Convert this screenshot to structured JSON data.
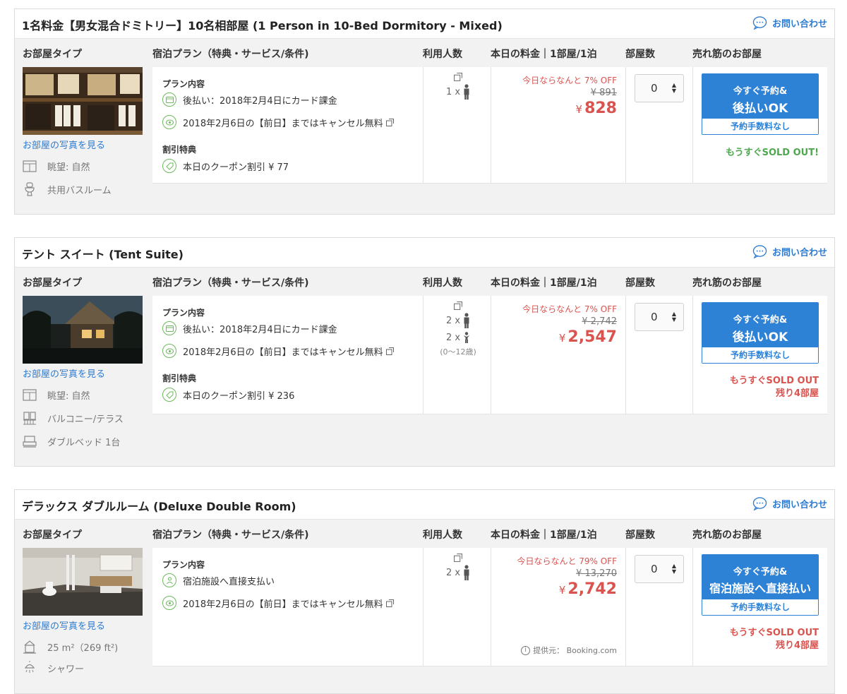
{
  "columns": {
    "room_type": "お部屋タイプ",
    "plan": "宿泊プラン（特典・サービス/条件)",
    "guests": "利用人数",
    "price": "本日の料金｜1部屋/1泊",
    "rooms": "部屋数",
    "bestseller": "売れ筋のお部屋"
  },
  "contact_label": "お問い合わせ",
  "photo_link": "お部屋の写真を見る",
  "plan_heading": "プラン内容",
  "discount_heading": "割引特典",
  "booking_fee": "予約手数料なし",
  "rooms": [
    {
      "title": "1名料金【男女混合ドミトリー】10名相部屋 (1 Person in 10-Bed Dormitory - Mixed)",
      "features": [
        {
          "icon": "window-icon",
          "label": "眺望: 自然"
        },
        {
          "icon": "toilet-icon",
          "label": "共用バスルーム"
        }
      ],
      "plan_lines": [
        {
          "icon": "card-icon",
          "text": "後払い：2018年2月4日にカード課金"
        },
        {
          "icon": "cancel-free-icon",
          "text": "2018年2月6日の【前日】まではキャンセル無料"
        }
      ],
      "coupon": "本日のクーポン割引 ¥ 77",
      "guests_adult": "1 x",
      "discount": "今日ならなんと 7% OFF",
      "original_price": "¥ 891",
      "price_yen": "¥",
      "price": "828",
      "qty": "0",
      "btn_line1": "今すぐ予約&",
      "btn_line2": "後払いOK",
      "status": "もうすぐSOLD OUT!"
    },
    {
      "title": "テント スイート (Tent Suite)",
      "features": [
        {
          "icon": "window-icon",
          "label": "眺望: 自然"
        },
        {
          "icon": "balcony-icon",
          "label": "バルコニー/テラス"
        },
        {
          "icon": "bed-icon",
          "label": "ダブルベッド 1台"
        }
      ],
      "plan_lines": [
        {
          "icon": "card-icon",
          "text": "後払い：2018年2月4日にカード課金"
        },
        {
          "icon": "cancel-free-icon",
          "text": "2018年2月6日の【前日】まではキャンセル無料"
        }
      ],
      "coupon": "本日のクーポン割引 ¥ 236",
      "guests_adult": "2 x",
      "guests_child": "2 x",
      "child_note": "(0〜12歳)",
      "discount": "今日ならなんと 7% OFF",
      "original_price": "¥ 2,742",
      "price_yen": "¥",
      "price": "2,547",
      "qty": "0",
      "btn_line1": "今すぐ予約&",
      "btn_line2": "後払いOK",
      "status": "もうすぐSOLD OUT",
      "status2": "残り4部屋"
    },
    {
      "title": "デラックス ダブルルーム (Deluxe Double Room)",
      "features": [
        {
          "icon": "area-icon",
          "label": "25 m²（269 ft²)"
        },
        {
          "icon": "shower-icon",
          "label": "シャワー"
        }
      ],
      "plan_lines": [
        {
          "icon": "pay-at-hotel-icon",
          "text": "宿泊施設へ直接支払い"
        },
        {
          "icon": "cancel-free-icon",
          "text": "2018年2月6日の【前日】まではキャンセル無料"
        }
      ],
      "guests_adult": "2 x",
      "discount": "今日ならなんと 79% OFF",
      "original_price": "¥ 13,270",
      "price_yen": "¥",
      "price": "2,742",
      "provider": "提供元： Booking.com",
      "qty": "0",
      "btn_line1": "今すぐ予約&",
      "btn_line2": "宿泊施設へ直接払い",
      "status": "もうすぐSOLD OUT",
      "status2": "残り4部屋"
    }
  ],
  "colors": {
    "accent_blue": "#2d82d6",
    "price_red": "#d9534f",
    "soldout_green": "#4ea84d",
    "plan_icon_green": "#6cba5c"
  }
}
